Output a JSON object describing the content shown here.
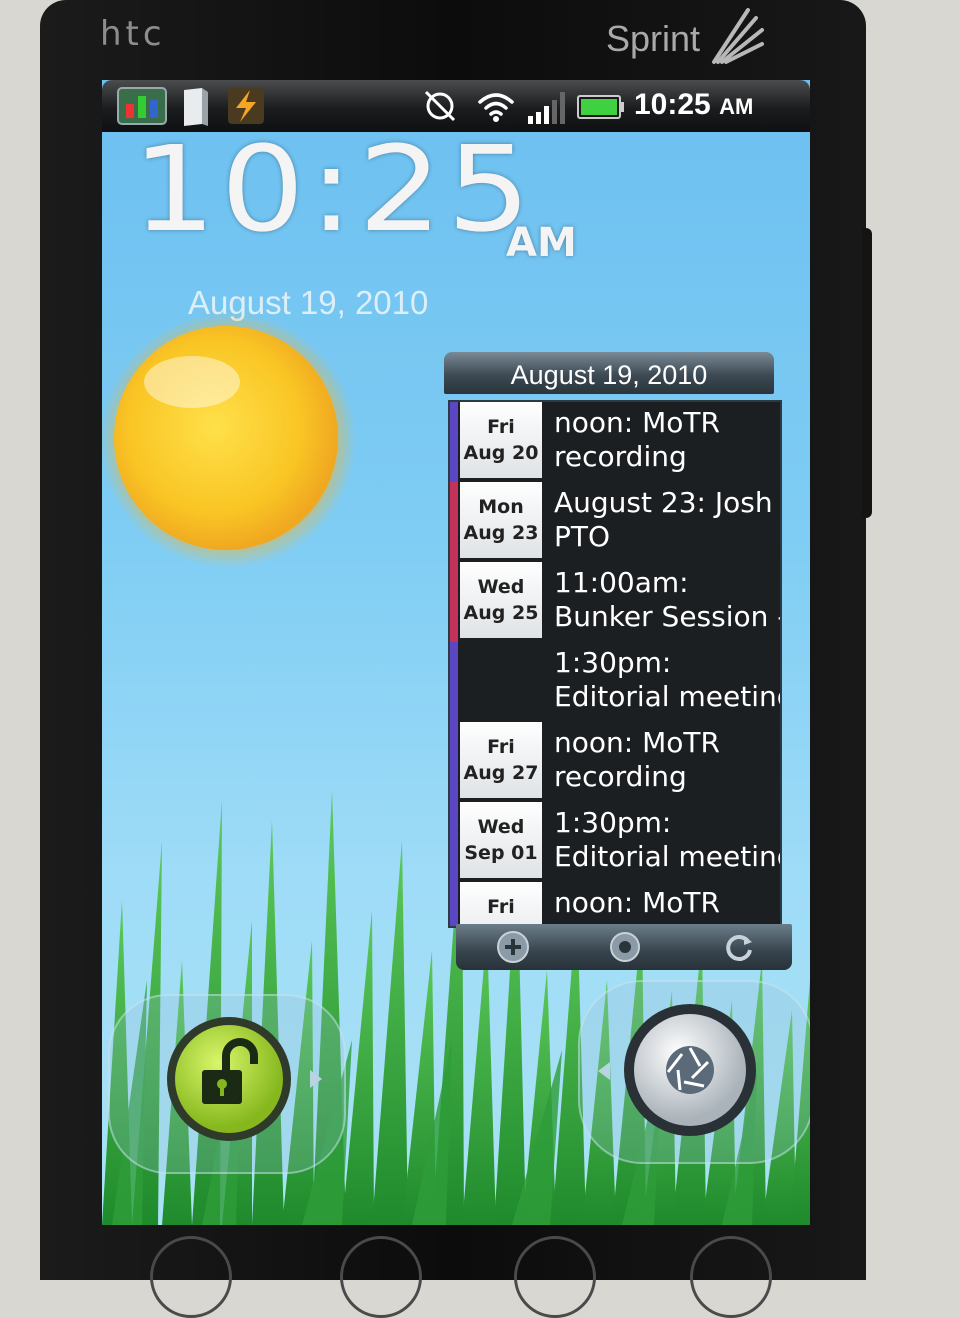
{
  "device": {
    "brand": "htc",
    "carrier": "Sprint"
  },
  "status_bar": {
    "icons": [
      "market-app-icon",
      "notes-icon",
      "flash-icon",
      "sync-off-icon",
      "wifi-icon",
      "signal-bars-icon",
      "battery-icon"
    ],
    "time": "10:25",
    "ampm": "AM"
  },
  "clock_widget": {
    "time": "10:25",
    "ampm": "AM",
    "date": "August 19, 2010"
  },
  "weather": {
    "icon": "sun-icon"
  },
  "calendar_widget": {
    "header": "August 19, 2010",
    "events": [
      {
        "day": "Fri",
        "date": "Aug 20",
        "line1": "noon: MoTR",
        "line2": "recording",
        "color": "#5b46c4"
      },
      {
        "day": "Mon",
        "date": "Aug 23",
        "line1": "August 23: Josh",
        "line2": "PTO",
        "color": "#c2325a"
      },
      {
        "day": "Wed",
        "date": "Aug 25",
        "line1": "11:00am:",
        "line2": "Bunker Session -",
        "color": "#c2325a"
      },
      {
        "day": "",
        "date": "",
        "line1": "1:30pm:",
        "line2": "Editorial meeting",
        "color": "#5b46c4"
      },
      {
        "day": "Fri",
        "date": "Aug 27",
        "line1": "noon: MoTR",
        "line2": "recording",
        "color": "#5b46c4"
      },
      {
        "day": "Wed",
        "date": "Sep 01",
        "line1": "1:30pm:",
        "line2": "Editorial meeting",
        "color": "#5b46c4"
      },
      {
        "day": "Fri",
        "date": "",
        "line1": "noon: MoTR",
        "line2": "",
        "color": "#5b46c4"
      }
    ],
    "footer_icons": [
      "add-event-icon",
      "settings-icon",
      "refresh-icon"
    ]
  },
  "lockscreen": {
    "unlock_icon": "unlock-icon",
    "camera_icon": "camera-icon"
  },
  "hardware_keys": [
    "home-key",
    "menu-key",
    "back-key",
    "search-key"
  ],
  "colors": {
    "sky": "#7fcdf4",
    "grass": "#3cb043",
    "unlock_green": "#a6d22b",
    "calendar_bg": "#1b1f22"
  }
}
